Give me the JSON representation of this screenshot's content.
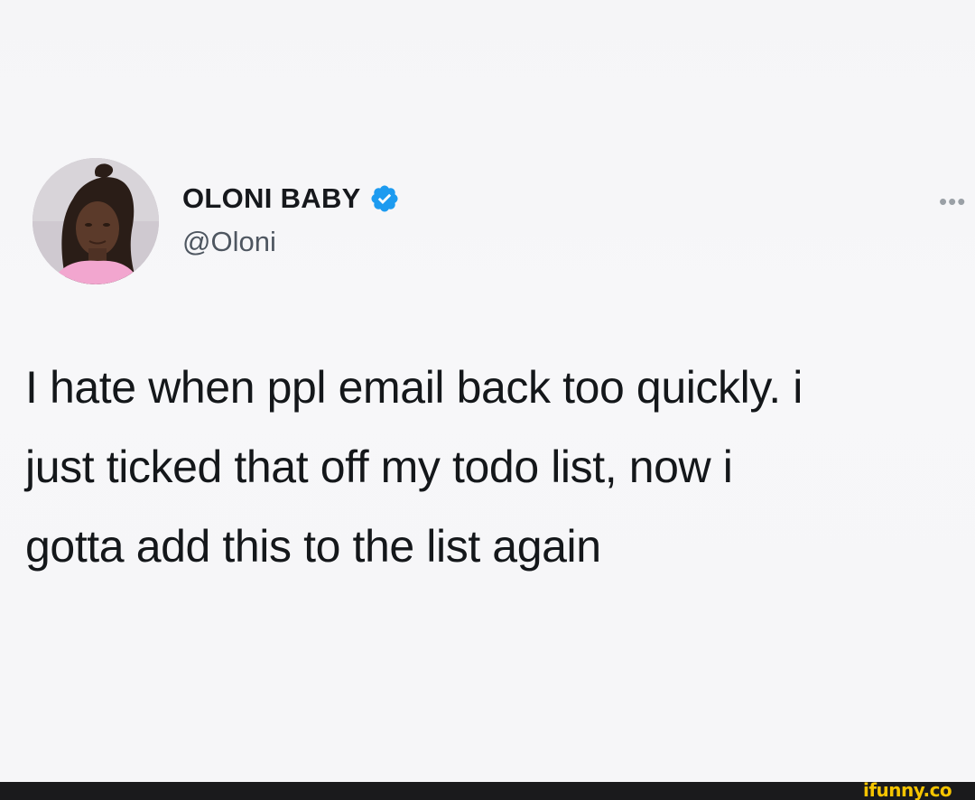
{
  "tweet": {
    "display_name": "OLONI BABY",
    "handle": "@Oloni",
    "more_icon": "more-dots-icon",
    "verified_icon": "verified-badge-icon",
    "text_lines": [
      "I hate when ppl email back too quickly. i",
      "just ticked that off my todo list, now i",
      "gotta add this to the list again"
    ]
  },
  "colors": {
    "verified": "#1d9bf0",
    "watermark": "#f5c400"
  },
  "watermark": {
    "text": "ifunny.co"
  }
}
